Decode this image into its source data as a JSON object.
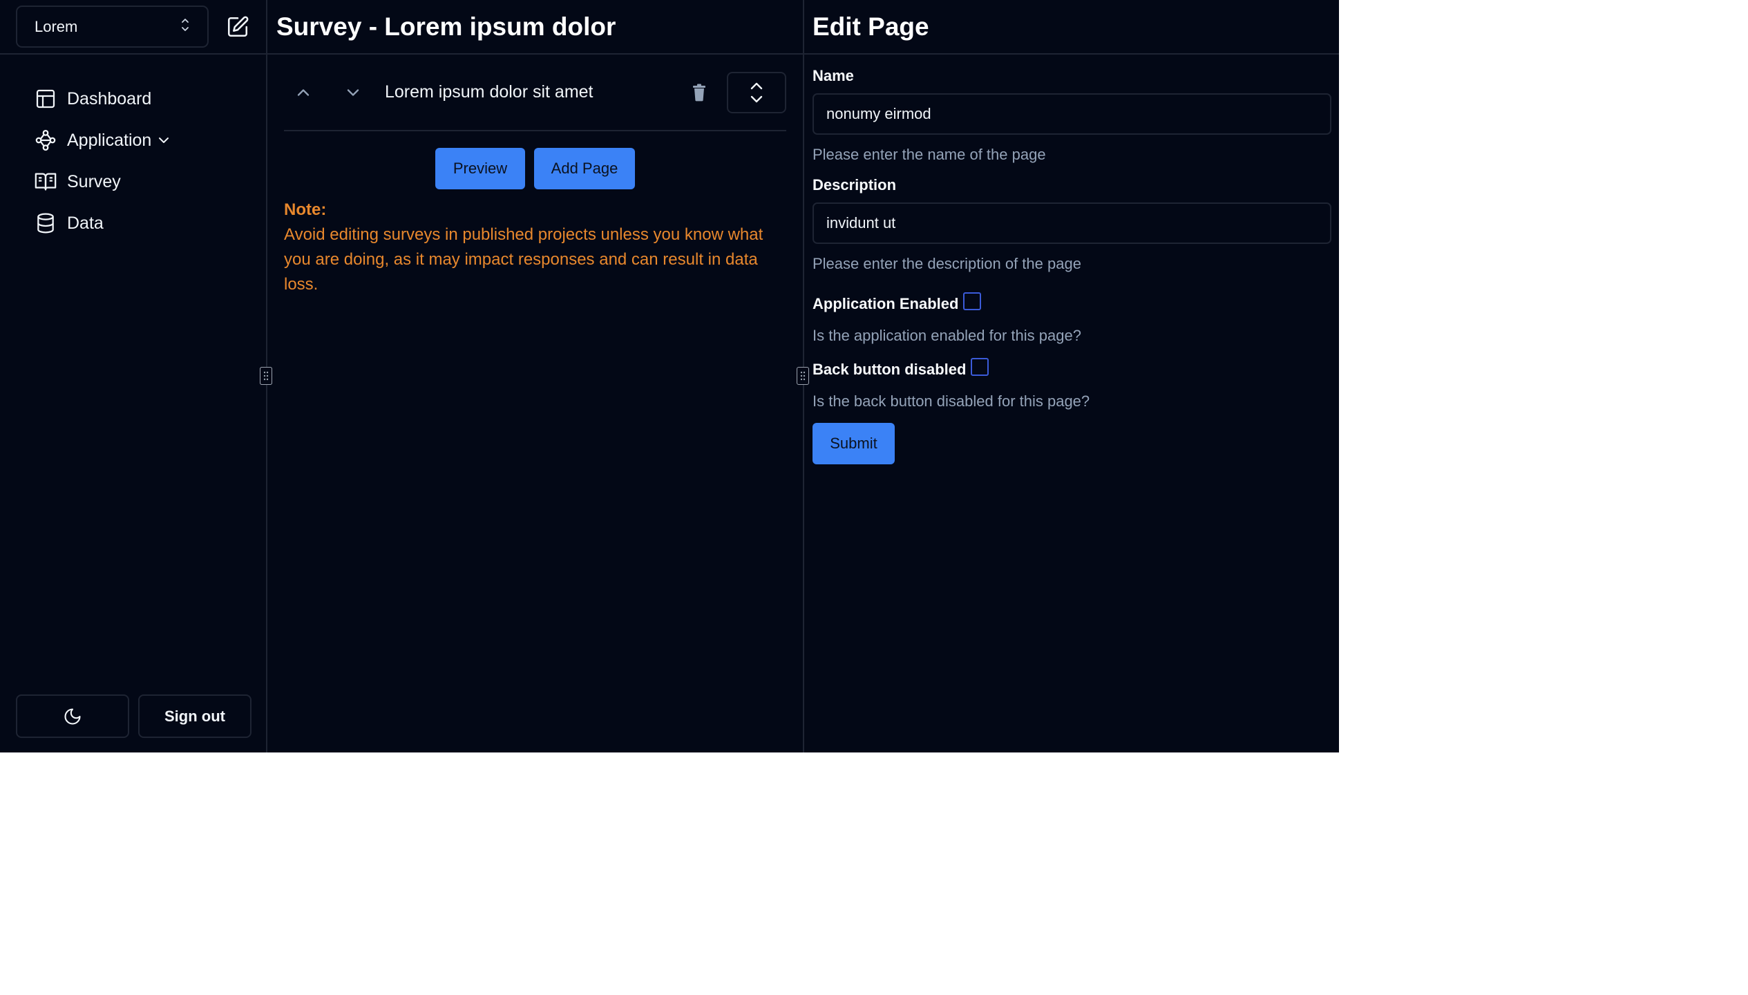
{
  "sidebar": {
    "workspace": "Lorem",
    "nav": [
      {
        "label": "Dashboard",
        "icon": "layout-icon"
      },
      {
        "label": "Application",
        "icon": "workflow-icon"
      },
      {
        "label": "Survey",
        "icon": "book-icon"
      },
      {
        "label": "Data",
        "icon": "database-icon"
      }
    ],
    "sign_out": "Sign out"
  },
  "middle": {
    "title": "Survey - Lorem ipsum dolor",
    "page_item": "Lorem ipsum dolor sit amet",
    "preview_label": "Preview",
    "add_page_label": "Add Page",
    "note_title": "Note:",
    "note_text": "Avoid editing surveys in published projects unless you know what you are doing, as it may impact responses and can result in data loss."
  },
  "edit": {
    "title": "Edit Page",
    "name_label": "Name",
    "name_value": "nonumy eirmod",
    "name_help": "Please enter the name of the page",
    "description_label": "Description",
    "description_value": "invidunt ut",
    "description_help": "Please enter the description of the page",
    "app_enabled_label": "Application Enabled",
    "app_enabled_help": "Is the application enabled for this page?",
    "back_disabled_label": "Back button disabled",
    "back_disabled_help": "Is the back button disabled for this page?",
    "submit_label": "Submit"
  },
  "colors": {
    "background": "#030816",
    "border": "#1e2433",
    "accent": "#3b82f6",
    "warning": "#e8882d",
    "muted": "#94a3b8"
  }
}
